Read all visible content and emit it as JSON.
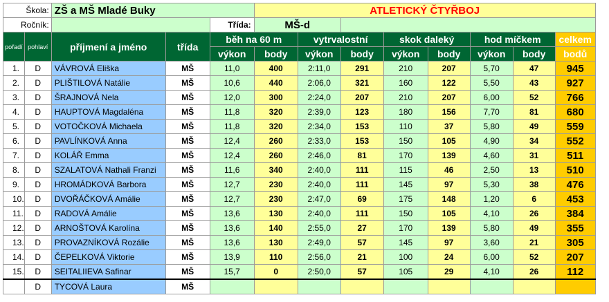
{
  "header": {
    "school_label": "Škola:",
    "school_value": "ZŠ a MŠ Mladé Buky",
    "title": "ATLETICKÝ ČTYŘBOJ",
    "year_label": "Ročník:",
    "class_label": "Třída:",
    "class_value": "MŠ-d"
  },
  "columns": {
    "order": "pořadí",
    "gender": "pohlaví",
    "name": "příjmení a jméno",
    "class": "třída",
    "ev1": "běh na 60 m",
    "ev2": "vytrvalostní",
    "ev3": "skok daleký",
    "ev4": "hod míčkem",
    "total_top": "celkem",
    "total_bottom": "bodů",
    "vykon": "výkon",
    "body": "body"
  },
  "rows": [
    {
      "rank": "1.",
      "g": "D",
      "name": "VÁVROVÁ Eliška",
      "cls": "MŠ",
      "v1": "11,0",
      "b1": "400",
      "v2": "2:11,0",
      "b2": "291",
      "v3": "210",
      "b3": "207",
      "v4": "5,70",
      "b4": "47",
      "total": "945"
    },
    {
      "rank": "2.",
      "g": "D",
      "name": "PLIŠTILOVÁ Natálie",
      "cls": "MŠ",
      "v1": "10,6",
      "b1": "440",
      "v2": "2:06,0",
      "b2": "321",
      "v3": "160",
      "b3": "122",
      "v4": "5,50",
      "b4": "43",
      "total": "927"
    },
    {
      "rank": "3.",
      "g": "D",
      "name": "ŠRAJNOVÁ Nela",
      "cls": "MŠ",
      "v1": "12,0",
      "b1": "300",
      "v2": "2:24,0",
      "b2": "207",
      "v3": "210",
      "b3": "207",
      "v4": "6,00",
      "b4": "52",
      "total": "766"
    },
    {
      "rank": "4.",
      "g": "D",
      "name": "HAUPTOVÁ Magdaléna",
      "cls": "MŠ",
      "v1": "11,8",
      "b1": "320",
      "v2": "2:39,0",
      "b2": "123",
      "v3": "180",
      "b3": "156",
      "v4": "7,70",
      "b4": "81",
      "total": "680"
    },
    {
      "rank": "5.",
      "g": "D",
      "name": "VOTOČKOVÁ Michaela",
      "cls": "MŠ",
      "v1": "11,8",
      "b1": "320",
      "v2": "2:34,0",
      "b2": "153",
      "v3": "110",
      "b3": "37",
      "v4": "5,80",
      "b4": "49",
      "total": "559"
    },
    {
      "rank": "6.",
      "g": "D",
      "name": "PAVLÍNKOVÁ Anna",
      "cls": "MŠ",
      "v1": "12,4",
      "b1": "260",
      "v2": "2:33,0",
      "b2": "153",
      "v3": "150",
      "b3": "105",
      "v4": "4,90",
      "b4": "34",
      "total": "552"
    },
    {
      "rank": "7.",
      "g": "D",
      "name": "KOLÁŘ Emma",
      "cls": "MŠ",
      "v1": "12,4",
      "b1": "260",
      "v2": "2:46,0",
      "b2": "81",
      "v3": "170",
      "b3": "139",
      "v4": "4,60",
      "b4": "31",
      "total": "511"
    },
    {
      "rank": "8.",
      "g": "D",
      "name": "SZALATOVÁ Nathali Franzi",
      "cls": "MŠ",
      "v1": "11,6",
      "b1": "340",
      "v2": "2:40,0",
      "b2": "111",
      "v3": "115",
      "b3": "46",
      "v4": "2,50",
      "b4": "13",
      "total": "510"
    },
    {
      "rank": "9.",
      "g": "D",
      "name": "HROMÁDKOVÁ Barbora",
      "cls": "MŠ",
      "v1": "12,7",
      "b1": "230",
      "v2": "2:40,0",
      "b2": "111",
      "v3": "145",
      "b3": "97",
      "v4": "5,30",
      "b4": "38",
      "total": "476"
    },
    {
      "rank": "10.",
      "g": "D",
      "name": "DVOŘÁČKOVÁ Amálie",
      "cls": "MŠ",
      "v1": "12,7",
      "b1": "230",
      "v2": "2:47,0",
      "b2": "69",
      "v3": "175",
      "b3": "148",
      "v4": "1,20",
      "b4": "6",
      "total": "453"
    },
    {
      "rank": "11.",
      "g": "D",
      "name": "RADOVÁ Amálie",
      "cls": "MŠ",
      "v1": "13,6",
      "b1": "130",
      "v2": "2:40,0",
      "b2": "111",
      "v3": "150",
      "b3": "105",
      "v4": "4,10",
      "b4": "26",
      "total": "384"
    },
    {
      "rank": "12.",
      "g": "D",
      "name": "ARNOŠTOVÁ Karolína",
      "cls": "MŠ",
      "v1": "13,6",
      "b1": "140",
      "v2": "2:55,0",
      "b2": "27",
      "v3": "170",
      "b3": "139",
      "v4": "5,80",
      "b4": "49",
      "total": "355"
    },
    {
      "rank": "13.",
      "g": "D",
      "name": "PROVAZNÍKOVÁ Rozálie",
      "cls": "MŠ",
      "v1": "13,6",
      "b1": "130",
      "v2": "2:49,0",
      "b2": "57",
      "v3": "145",
      "b3": "97",
      "v4": "3,60",
      "b4": "21",
      "total": "305"
    },
    {
      "rank": "14.",
      "g": "D",
      "name": "ČEPELKOVÁ Viktorie",
      "cls": "MŠ",
      "v1": "13,9",
      "b1": "110",
      "v2": "2:56,0",
      "b2": "21",
      "v3": "100",
      "b3": "24",
      "v4": "6,00",
      "b4": "52",
      "total": "207"
    },
    {
      "rank": "15.",
      "g": "D",
      "name": "SEITALIIEVA Safinar",
      "cls": "MŠ",
      "v1": "15,7",
      "b1": "0",
      "v2": "2:50,0",
      "b2": "57",
      "v3": "105",
      "b3": "29",
      "v4": "4,10",
      "b4": "26",
      "total": "112"
    },
    {
      "rank": "",
      "g": "D",
      "name": "TYCOVÁ Laura",
      "cls": "MŠ",
      "v1": "",
      "b1": "",
      "v2": "",
      "b2": "",
      "v3": "",
      "b3": "",
      "v4": "",
      "b4": "",
      "total": ""
    }
  ]
}
